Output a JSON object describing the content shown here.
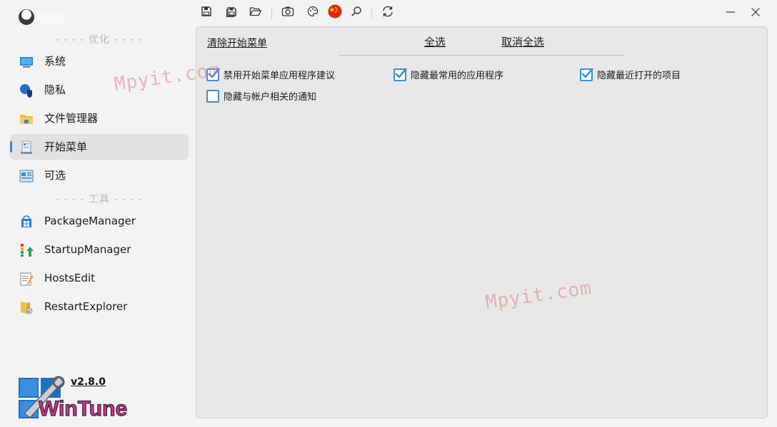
{
  "window": {
    "minimize_icon": "minimize-icon",
    "close_icon": "close-icon"
  },
  "toolbar": {
    "buttons": [
      "save-icon",
      "save-all-icon",
      "open-folder-icon",
      "screenshot-icon",
      "palette-icon",
      "language-flag-icon",
      "search-icon",
      "refresh-icon"
    ]
  },
  "sidebar": {
    "section_optimize": "- - - - 优化 - - - -",
    "section_tools": "- - - - 工具 - - - -",
    "items": [
      {
        "label": "系统",
        "icon": "system-monitor-icon"
      },
      {
        "label": "隐私",
        "icon": "privacy-shield-icon"
      },
      {
        "label": "文件管理器",
        "icon": "file-explorer-icon"
      },
      {
        "label": "开始菜单",
        "icon": "start-menu-icon",
        "active": true
      },
      {
        "label": "可选",
        "icon": "optional-features-icon"
      }
    ],
    "tools": [
      {
        "label": "PackageManager",
        "icon": "package-manager-icon"
      },
      {
        "label": "StartupManager",
        "icon": "startup-manager-icon"
      },
      {
        "label": "HostsEdit",
        "icon": "hosts-edit-icon"
      },
      {
        "label": "RestartExplorer",
        "icon": "restart-explorer-icon"
      }
    ],
    "version": "v2.8.0",
    "logo_text": "WinTune"
  },
  "main": {
    "clear_start_menu": "清除开始菜单",
    "select_all": "全选",
    "deselect_all": "取消全选",
    "options": [
      {
        "label": "禁用开始菜单应用程序建议",
        "checked": true
      },
      {
        "label": "隐藏最常用的应用程序",
        "checked": true
      },
      {
        "label": "隐藏最近打开的项目",
        "checked": true
      },
      {
        "label": "隐藏与帐户相关的通知",
        "checked": false
      }
    ]
  },
  "watermark": "Mpyit.com",
  "colors": {
    "accent": "#2f8bd8",
    "checkbox": "#3d8fd6",
    "panel_bg": "#e8e8e8",
    "window_bg": "#f3f3f3",
    "watermark": "#e47e7e"
  }
}
